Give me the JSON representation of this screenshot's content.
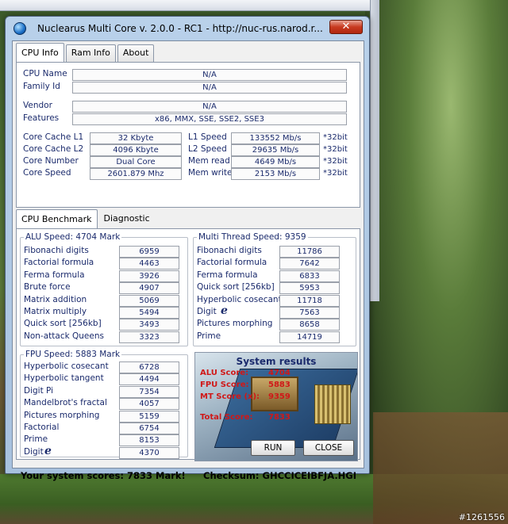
{
  "window": {
    "title": "Nuclearus Multi Core  v. 2.0.0   -   RC1   -   http://nuc-rus.narod.r...",
    "close": "✕"
  },
  "tabs": [
    {
      "label": "CPU Info"
    },
    {
      "label": "Ram Info"
    },
    {
      "label": "About"
    }
  ],
  "cpu_info": {
    "cpu_name_label": "CPU Name",
    "cpu_name": "N/A",
    "family_label": "Family Id",
    "family": "N/A",
    "vendor_label": "Vendor",
    "vendor": "N/A",
    "features_label": "Features",
    "features": "x86, MMX, SSE, SSE2, SSE3",
    "l1_label": "Core Cache L1",
    "l1": "32 Kbyte",
    "l2_label": "Core Cache L2",
    "l2": "4096 Kbyte",
    "cores_label": "Core Number",
    "cores": "Dual Core",
    "speed_label": "Core Speed",
    "speed": "2601.879 Mhz",
    "l1s_label": "L1 Speed",
    "l1s": "133552 Mb/s",
    "l2s_label": "L2 Speed",
    "l2s": "29635 Mb/s",
    "mr_label": "Mem read",
    "mr": "4649 Mb/s",
    "mw_label": "Mem write",
    "mw": "2153 Mb/s",
    "suffix": "*32bit"
  },
  "bench_tabs": [
    {
      "label": "CPU Benchmark"
    },
    {
      "label": "Diagnostic"
    }
  ],
  "alu": {
    "title": "ALU Speed: 4704 Mark",
    "rows": [
      {
        "label": "Fibonachi digits",
        "value": "6959"
      },
      {
        "label": "Factorial formula",
        "value": "4463"
      },
      {
        "label": "Ferma formula",
        "value": "3926"
      },
      {
        "label": "Brute force",
        "value": "4907"
      },
      {
        "label": "Matrix addition",
        "value": "5069"
      },
      {
        "label": "Matrix multiply",
        "value": "5494"
      },
      {
        "label": "Quick sort [256kb]",
        "value": "3493"
      },
      {
        "label": "Non-attack Queens",
        "value": "3323"
      }
    ]
  },
  "mt": {
    "title": "Multi Thread Speed: 9359",
    "rows": [
      {
        "label": "Fibonachi digits",
        "value": "11786"
      },
      {
        "label": "Factorial formula",
        "value": "7642"
      },
      {
        "label": "Ferma formula",
        "value": "6833"
      },
      {
        "label": "Quick sort [256kb]",
        "value": "5953"
      },
      {
        "label": "Hyperbolic cosecant",
        "value": "11718"
      },
      {
        "label": "Digit",
        "value": "7563"
      },
      {
        "label": "Pictures morphing",
        "value": "8658"
      },
      {
        "label": "Prime",
        "value": "14719"
      }
    ]
  },
  "fpu": {
    "title": "FPU Speed: 5883 Mark",
    "rows": [
      {
        "label": "Hyperbolic cosecant",
        "value": "6728"
      },
      {
        "label": "Hyperbolic tangent",
        "value": "4494"
      },
      {
        "label": "Digit Pi",
        "value": "7354"
      },
      {
        "label": "Mandelbrot's fractal",
        "value": "4057"
      },
      {
        "label": "Pictures morphing",
        "value": "5159"
      },
      {
        "label": "Factorial",
        "value": "6754"
      },
      {
        "label": "Prime",
        "value": "8153"
      },
      {
        "label": "Digit",
        "value": "4370"
      }
    ]
  },
  "e_symbol": "e",
  "results": {
    "title": "System results",
    "alu_label": "ALU Score:",
    "alu": "4704",
    "fpu_label": "FPU Score:",
    "fpu": "5883",
    "mt_label": "MT Score (x):",
    "mt": "9359",
    "total_label": "Total Score:",
    "total": "7833"
  },
  "buttons": {
    "run": "RUN",
    "close": "CLOSE"
  },
  "status": {
    "scores": "Your system scores: 7833 Mark!",
    "checksum": "Checksum: GHCCICEIBFJA.HGI"
  },
  "watermark": "#1261556"
}
